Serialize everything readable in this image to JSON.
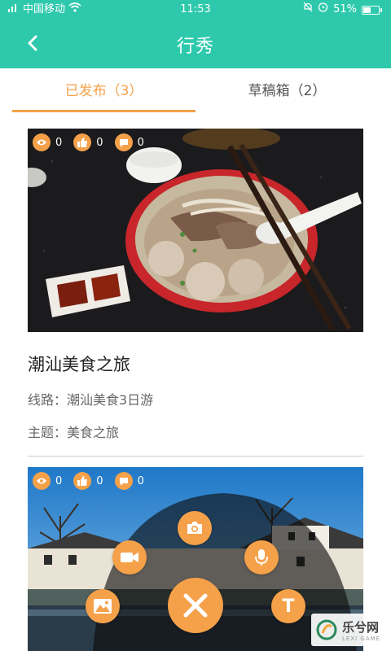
{
  "status_bar": {
    "carrier": "中国移动",
    "time": "11:53",
    "battery": "51%",
    "battery_level": 0.51
  },
  "header": {
    "title": "行秀"
  },
  "tabs": [
    {
      "label": "已发布（3）",
      "active": true
    },
    {
      "label": "草稿箱（2）",
      "active": false
    }
  ],
  "cards": [
    {
      "views": "0",
      "likes": "0",
      "comments": "0",
      "title": "潮汕美食之旅",
      "route": "线路：潮汕美食3日游",
      "theme": "主题：美食之旅"
    },
    {
      "views": "0",
      "likes": "0",
      "comments": "0"
    }
  ],
  "fab_menu": {
    "items": [
      "camera-icon",
      "video-icon",
      "mic-icon",
      "image-icon",
      "text-icon",
      "close-icon"
    ],
    "text_button_label": "T"
  },
  "watermark": {
    "text": "乐兮网",
    "sub": "LEXI GAME"
  },
  "colors": {
    "primary": "#2EC9AC",
    "accent": "#F5A14A"
  }
}
